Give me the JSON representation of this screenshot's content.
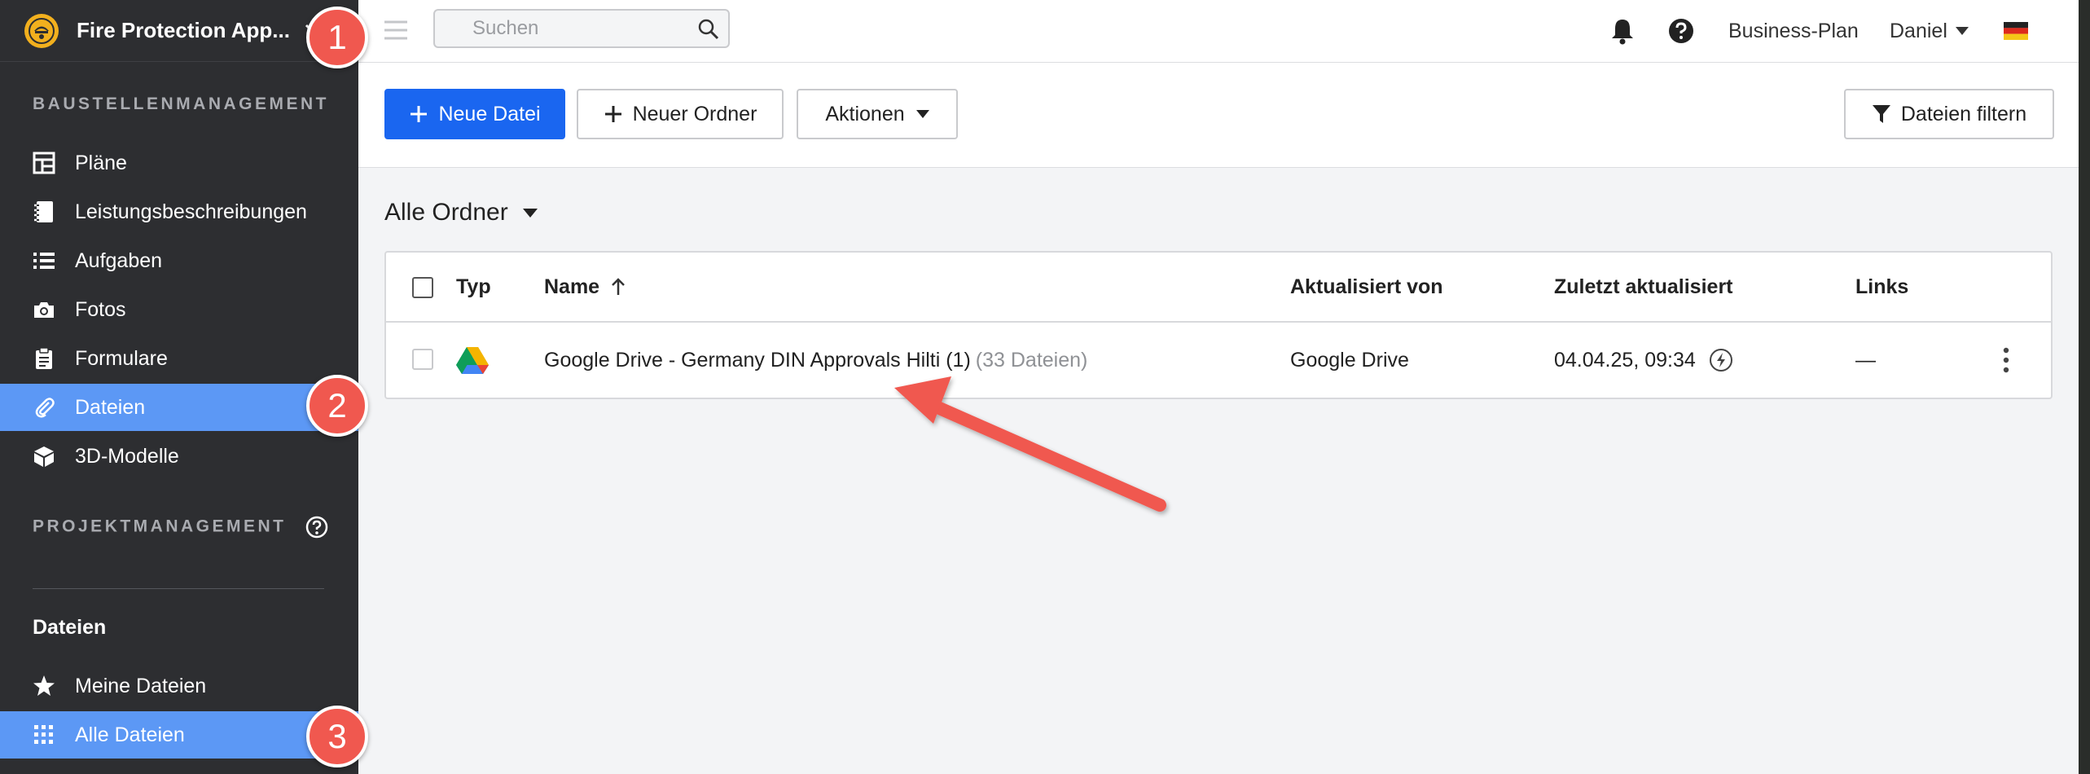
{
  "sidebar": {
    "project_name": "Fire Protection App...",
    "section_site": "BAUSTELLENMANAGEMENT",
    "site_items": [
      {
        "label": "Pläne",
        "icon": "plans-icon"
      },
      {
        "label": "Leistungsbeschreibungen",
        "icon": "notebook-icon"
      },
      {
        "label": "Aufgaben",
        "icon": "list-icon"
      },
      {
        "label": "Fotos",
        "icon": "camera-icon"
      },
      {
        "label": "Formulare",
        "icon": "clipboard-icon"
      },
      {
        "label": "Dateien",
        "icon": "paperclip-icon",
        "active": true
      },
      {
        "label": "3D-Modelle",
        "icon": "cube-icon"
      }
    ],
    "section_project": "PROJEKTMANAGEMENT",
    "files_heading": "Dateien",
    "file_items": [
      {
        "label": "Meine Dateien",
        "icon": "star-icon"
      },
      {
        "label": "Alle Dateien",
        "icon": "grid-icon",
        "active": true
      }
    ]
  },
  "topbar": {
    "search_placeholder": "Suchen",
    "plan": "Business-Plan",
    "user": "Daniel"
  },
  "toolbar": {
    "new_file": "Neue Datei",
    "new_folder": "Neuer Ordner",
    "actions": "Aktionen",
    "filter": "Dateien filtern"
  },
  "content": {
    "folder_title": "Alle Ordner",
    "columns": {
      "type": "Typ",
      "name": "Name",
      "updated_by": "Aktualisiert von",
      "last_updated": "Zuletzt aktualisiert",
      "links": "Links"
    },
    "rows": [
      {
        "name": "Google Drive - Germany DIN Approvals Hilti (1)",
        "count": "(33 Dateien)",
        "updated_by": "Google Drive",
        "last_updated": "04.04.25, 09:34",
        "links": "—"
      }
    ]
  },
  "annotations": {
    "badges": [
      "1",
      "2",
      "3"
    ]
  },
  "colors": {
    "sidebar_bg": "#2d2e31",
    "active_nav": "#5c98f5",
    "primary_button": "#1a66f0",
    "badge": "#f0584f"
  }
}
